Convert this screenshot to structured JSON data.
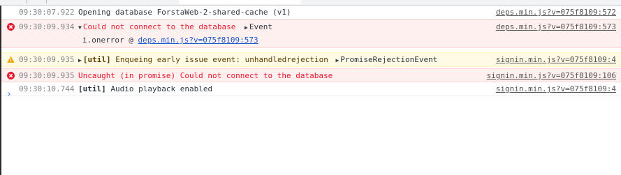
{
  "console": {
    "messages": [
      {
        "level": "info",
        "timestamp": "09:30:07.922",
        "text": "Opening database ForstaWeb-2-shared-cache (v1)",
        "source": "deps.min.js?v=075f8109:572"
      },
      {
        "level": "error",
        "timestamp": "09:30:09.934",
        "text": "Could not connect to the database",
        "object": "Event",
        "source": "deps.min.js?v=075f8109:573",
        "stack_prefix": "i.onerror @ ",
        "stack_link": "deps.min.js?v=075f8109:573"
      },
      {
        "level": "warning",
        "timestamp": "09:30:09.935",
        "tag": "[util]",
        "text": "Enqueing early issue event: unhandledrejection",
        "object": "PromiseRejectionEvent",
        "source": "signin.min.js?v=075f8109:4"
      },
      {
        "level": "error",
        "timestamp": "09:30:09.935",
        "text": "Uncaught (in promise) Could not connect to the database",
        "source": "signin.min.js?v=075f8109:106"
      },
      {
        "level": "info",
        "timestamp": "09:30:10.744",
        "tag": "[util]",
        "text": "Audio playback enabled",
        "source": "signin.min.js?v=075f8109:4"
      }
    ],
    "prompt_glyph": "›"
  },
  "colors": {
    "error_text": "#e8192c",
    "error_bg": "#fff0f0",
    "warning_bg": "#fffbe5",
    "link": "#1a57c7",
    "prompt": "#1a73e8"
  }
}
